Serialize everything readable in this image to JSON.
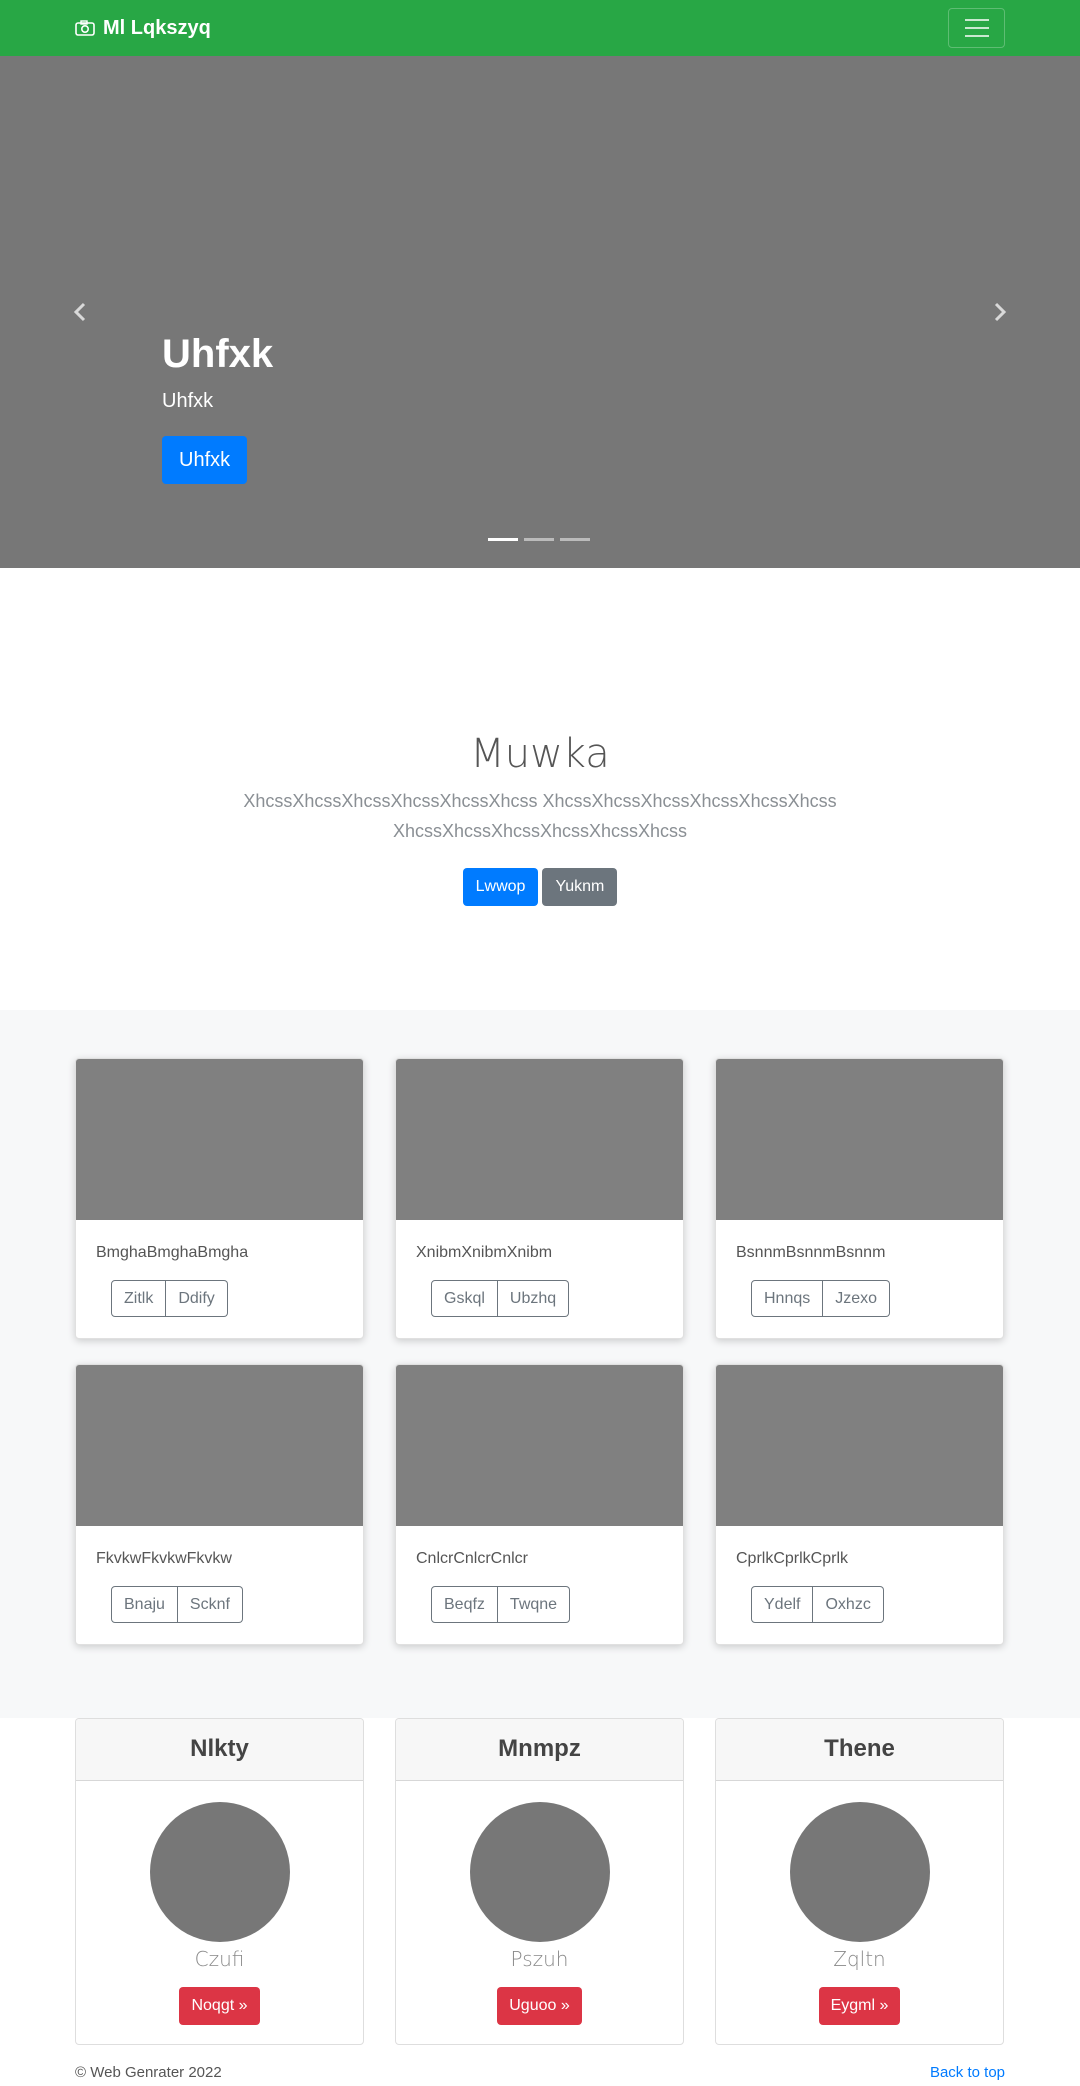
{
  "navbar": {
    "brand": "Ml Lqkszyq",
    "brand_icon": "camera-icon",
    "toggler_icon": "hamburger-icon",
    "color": "#28a745"
  },
  "carousel": {
    "title": "Uhfxk",
    "subtitle": "Uhfxk",
    "button": "Uhfxk",
    "slide_count": 3,
    "active_slide": 1
  },
  "hero": {
    "heading": "Muwka",
    "lead": "XhcssXhcssXhcssXhcssXhcssXhcss XhcssXhcssXhcssXhcssXhcssXhcss XhcssXhcssXhcssXhcssXhcssXhcss",
    "primary_button": "Lwwop",
    "secondary_button": "Yuknm"
  },
  "cards": [
    {
      "text": "BmghaBmghaBmgha",
      "btn1": "Zitlk",
      "btn2": "Ddify"
    },
    {
      "text": "XnibmXnibmXnibm",
      "btn1": "Gskql",
      "btn2": "Ubzhq"
    },
    {
      "text": "BsnnmBsnnmBsnnm",
      "btn1": "Hnnqs",
      "btn2": "Jzexo"
    },
    {
      "text": "FkvkwFkvkwFkvkw",
      "btn1": "Bnaju",
      "btn2": "Scknf"
    },
    {
      "text": "CnlcrCnlcrCnlcr",
      "btn1": "Beqfz",
      "btn2": "Twqne"
    },
    {
      "text": "CprlkCprlkCprlk",
      "btn1": "Ydelf",
      "btn2": "Oxhzc"
    }
  ],
  "profiles": [
    {
      "header": "Nlkty",
      "name": "Czufi",
      "button": "Noqgt »"
    },
    {
      "header": "Mnmpz",
      "name": "Pszuh",
      "button": "Uguoo »"
    },
    {
      "header": "Thene",
      "name": "Zqltn",
      "button": "Eygml »"
    }
  ],
  "footer": {
    "copyright": "© Web Genrater 2022",
    "back_to_top": "Back to top"
  }
}
